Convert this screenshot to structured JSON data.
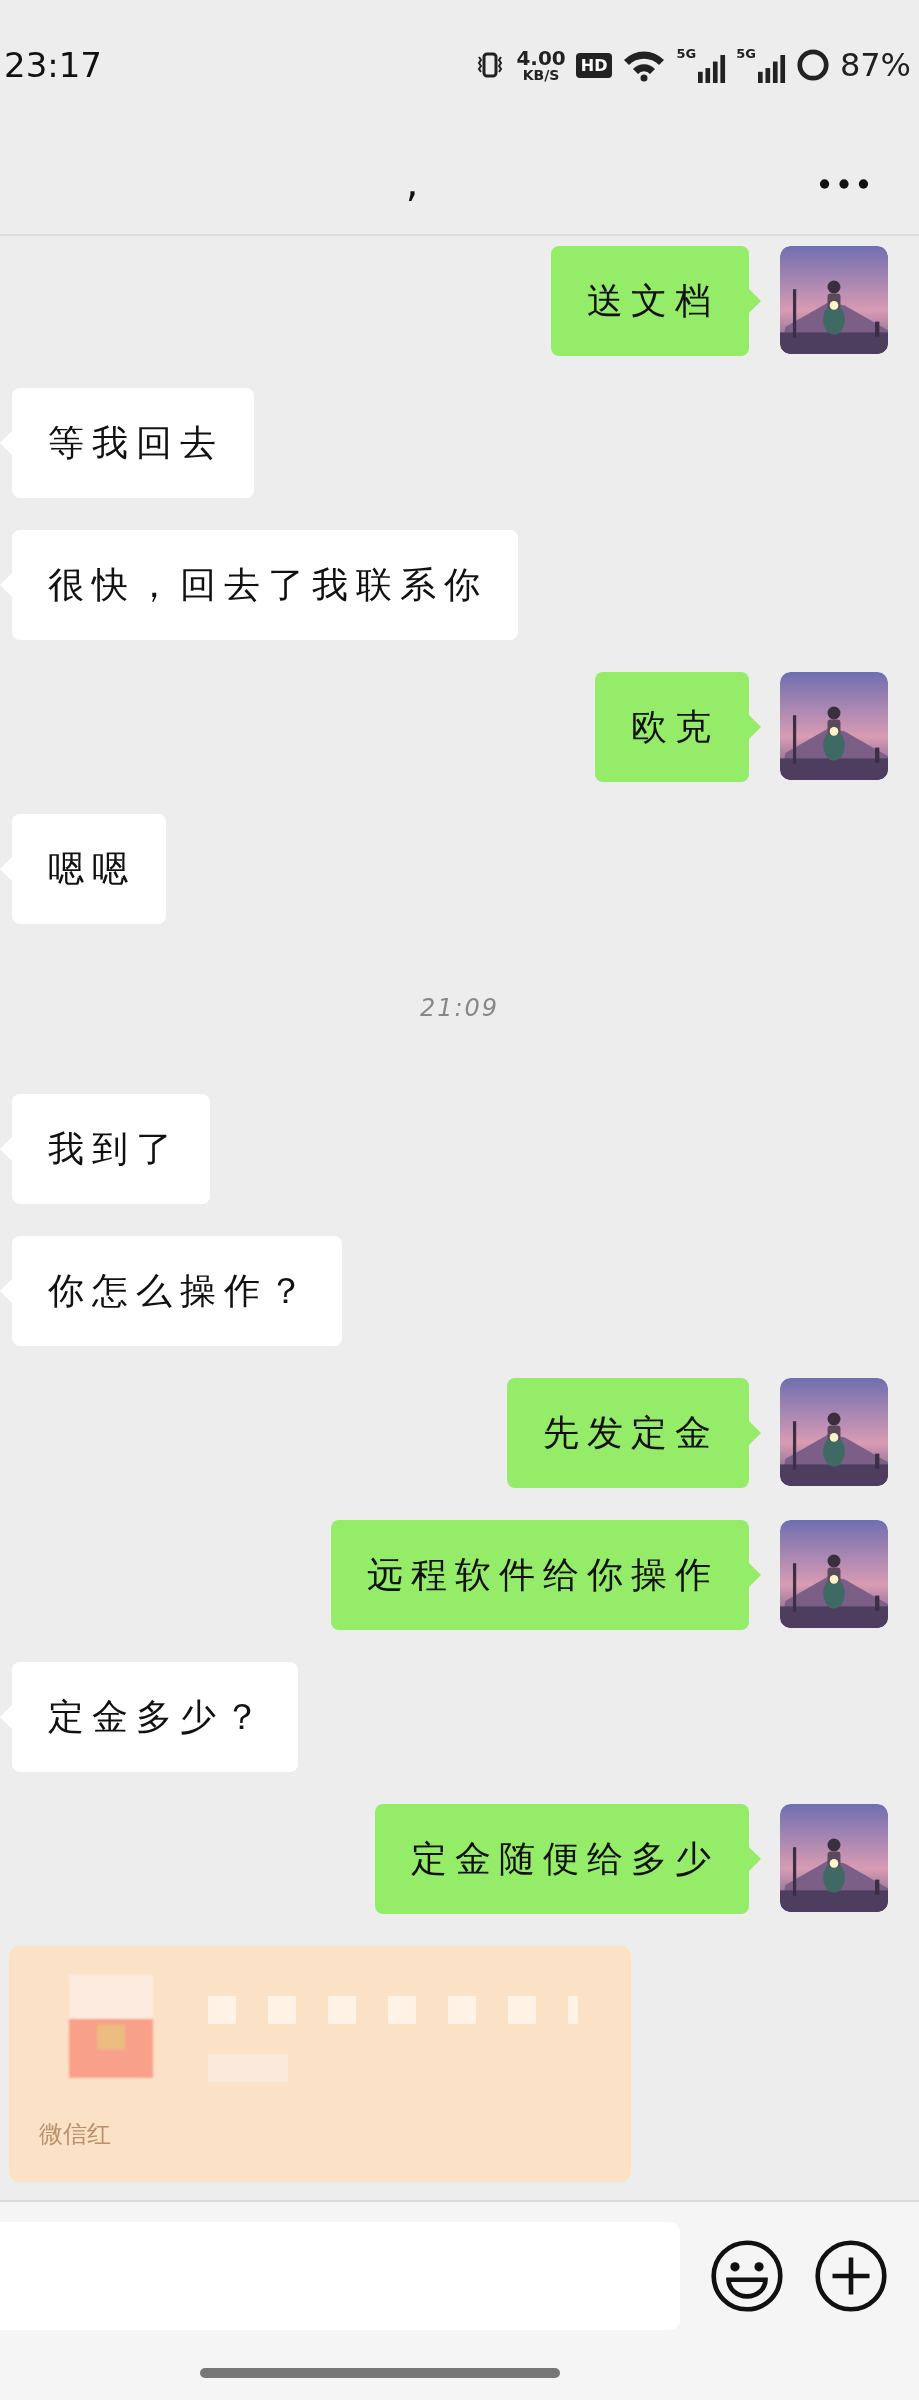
{
  "status_bar": {
    "time": "23:17",
    "speed_value": "4.00",
    "speed_unit": "KB/S",
    "hd_badge": "HD",
    "sim_1": "5G",
    "sim_2": "5G",
    "battery": "87%"
  },
  "header": {
    "title": ","
  },
  "messages": [
    {
      "kind": "text",
      "outgoing": true,
      "text": "送文档"
    },
    {
      "kind": "text",
      "outgoing": false,
      "text": "等我回去"
    },
    {
      "kind": "text",
      "outgoing": false,
      "text": "很快，回去了我联系你"
    },
    {
      "kind": "text",
      "outgoing": true,
      "text": "欧克"
    },
    {
      "kind": "text",
      "outgoing": false,
      "text": "嗯嗯"
    },
    {
      "kind": "time",
      "text": "21:09"
    },
    {
      "kind": "text",
      "outgoing": false,
      "text": "我到了"
    },
    {
      "kind": "text",
      "outgoing": false,
      "text": "你怎么操作？"
    },
    {
      "kind": "text",
      "outgoing": true,
      "text": "先发定金"
    },
    {
      "kind": "text",
      "outgoing": true,
      "text": "远程软件给你操作"
    },
    {
      "kind": "text",
      "outgoing": false,
      "text": "定金多少？"
    },
    {
      "kind": "text",
      "outgoing": true,
      "text": "定金随便给多少"
    },
    {
      "kind": "redpacket",
      "footer": "微信红"
    }
  ]
}
